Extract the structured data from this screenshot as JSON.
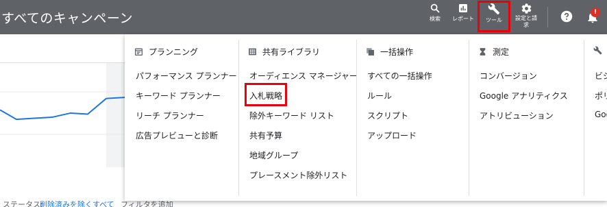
{
  "header": {
    "title": "すべてのキャンペーン",
    "search_label": "検索",
    "reports_label": "レポート",
    "tools_label": "ツール",
    "settings_label_line1": "設定と請",
    "settings_label_line2": "求",
    "notification_badge": "!"
  },
  "tools_menu": {
    "columns": [
      {
        "header": "プランニング",
        "icon": "calendar-icon",
        "items": [
          "パフォーマンス プランナー",
          "キーワード プランナー",
          "リーチ プランナー",
          "広告プレビューと診断"
        ]
      },
      {
        "header": "共有ライブラリ",
        "icon": "grid-icon",
        "items": [
          "オーディエンス マネージャー",
          "入札戦略",
          "除外キーワード リスト",
          "共有予算",
          "地域グループ",
          "プレースメント除外リスト"
        ]
      },
      {
        "header": "一括操作",
        "icon": "copy-icon",
        "items": [
          "すべての一括操作",
          "ルール",
          "スクリプト",
          "アップロード"
        ]
      },
      {
        "header": "測定",
        "icon": "hourglass-icon",
        "items": [
          "コンバージョン",
          "Google アナリティクス",
          "アトリビューション"
        ]
      },
      {
        "header": "",
        "icon": "wrench-icon",
        "items": [
          "ビジ",
          "ポリ",
          "Goo"
        ]
      }
    ]
  },
  "filter_bar": {
    "status_prefix": "ステータス: ",
    "status_value": "削除済みを除くすべて",
    "add_filter": "フィルタを追加"
  },
  "chart_data": {
    "type": "line",
    "title": "",
    "series": [
      {
        "values": [
          0.55,
          0.46,
          0.47,
          0.48,
          0.52,
          0.51,
          0.66,
          0.67
        ]
      }
    ]
  },
  "colors": {
    "topbar": "#5f6368",
    "highlight": "#e8000b",
    "accent": "#1a73e8",
    "badge": "#d93025"
  }
}
